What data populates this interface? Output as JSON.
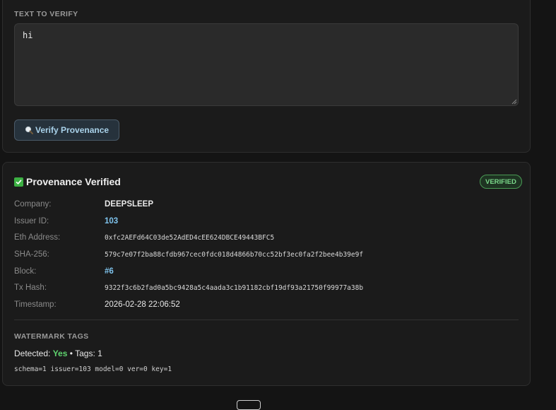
{
  "verify": {
    "label": "TEXT TO VERIFY",
    "text_value": "hi",
    "button_label": "Verify Provenance"
  },
  "result": {
    "title": "Provenance Verified",
    "badge": "VERIFIED",
    "rows": [
      {
        "key": "Company:",
        "value": "DEEPSLEEP"
      },
      {
        "key": "Issuer ID:",
        "value": "103"
      },
      {
        "key": "Eth Address:",
        "value": "0xfc2AEFd64C03de52AdED4cEE624DBCE49443BFC5"
      },
      {
        "key": "SHA-256:",
        "value": "579c7e07f2ba88cfdb967cec0fdc018d4866b70cc52bf3ec0fa2f2bee4b39e9f"
      },
      {
        "key": "Block:",
        "value": "#6"
      },
      {
        "key": "Tx Hash:",
        "value": "9322f3c6b2fad0a5bc9428a5c4aada3c1b91182cbf19df93a21750f99977a38b"
      },
      {
        "key": "Timestamp:",
        "value": "2026-02-28 22:06:52"
      }
    ],
    "watermark": {
      "label": "WATERMARK TAGS",
      "detected_prefix": "Detected:",
      "detected_value": "Yes",
      "separator": "•",
      "tags_text": "Tags: 1",
      "tags_line": "schema=1 issuer=103 model=0 ver=0 key=1"
    }
  },
  "colors": {
    "accent_link": "#7fc4ee",
    "success": "#5fd36e",
    "badge_border": "#4a9a55"
  },
  "icons": {
    "verify_button": "magnifier-icon",
    "title": "check-icon"
  }
}
